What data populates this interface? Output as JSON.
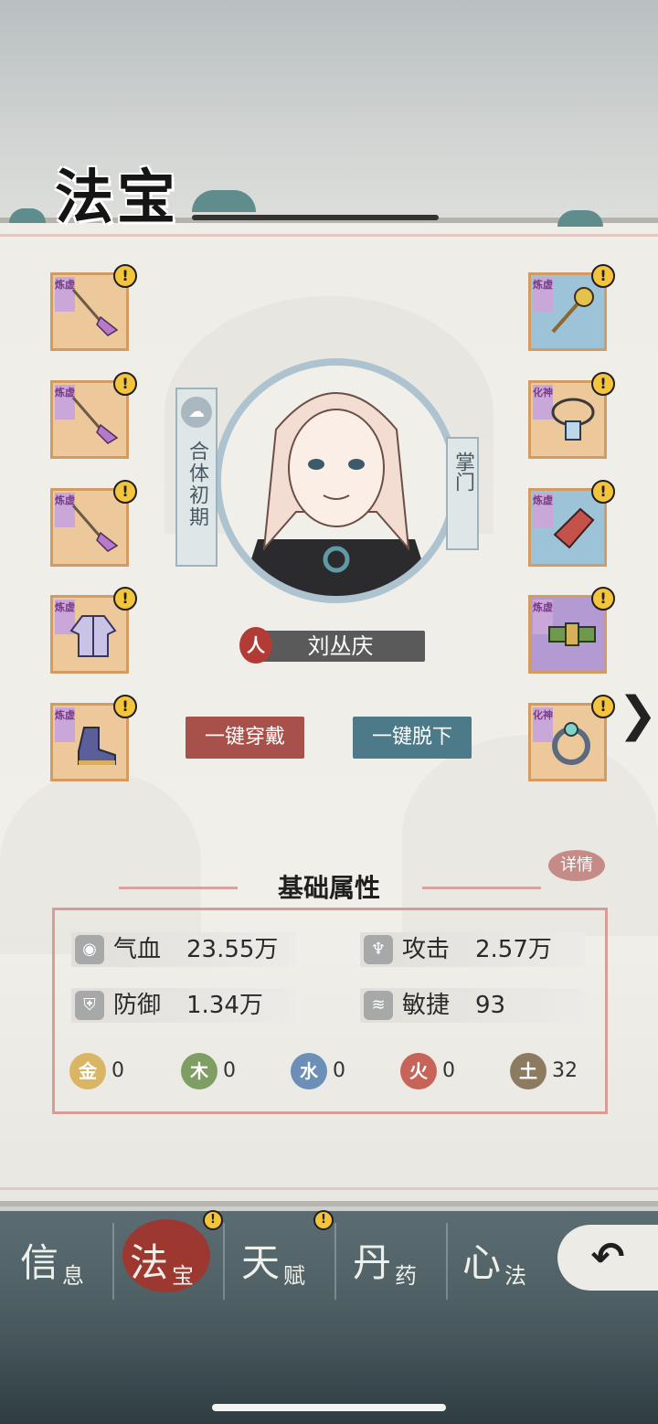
{
  "page": {
    "title": "法宝"
  },
  "slots_left": [
    {
      "tag": "炼虚",
      "icon": "polearm-icon",
      "badge": "!"
    },
    {
      "tag": "炼虚",
      "icon": "polearm-icon",
      "badge": "!"
    },
    {
      "tag": "炼虚",
      "icon": "polearm-icon",
      "badge": "!"
    },
    {
      "tag": "炼虚",
      "icon": "robe-icon",
      "badge": "!"
    },
    {
      "tag": "炼虚",
      "icon": "boots-icon",
      "badge": "!"
    }
  ],
  "slots_right": [
    {
      "tag": "炼虚",
      "icon": "hairpin-icon",
      "badge": "!"
    },
    {
      "tag": "化神",
      "icon": "necklace-icon",
      "badge": "!"
    },
    {
      "tag": "炼虚",
      "icon": "bracer-icon",
      "badge": "!"
    },
    {
      "tag": "炼虚",
      "icon": "belt-icon",
      "badge": "!"
    },
    {
      "tag": "化神",
      "icon": "ring-icon",
      "badge": "!"
    }
  ],
  "character": {
    "realm": "合体初期",
    "position": "掌门",
    "name_icon_char": "人",
    "name": "刘丛庆"
  },
  "buttons": {
    "equip_all": "一键穿戴",
    "unequip_all": "一键脱下",
    "detail": "详情"
  },
  "attributes": {
    "title": "基础属性",
    "stats": [
      {
        "label": "气血",
        "value": "23.55万",
        "icon": "blood-drop-icon"
      },
      {
        "label": "攻击",
        "value": "2.57万",
        "icon": "attack-icon"
      },
      {
        "label": "防御",
        "value": "1.34万",
        "icon": "shield-icon"
      },
      {
        "label": "敏捷",
        "value": "93",
        "icon": "wind-icon"
      }
    ],
    "elements": [
      {
        "char": "金",
        "value": "0",
        "color": "#d9b564"
      },
      {
        "char": "木",
        "value": "0",
        "color": "#7e9e63"
      },
      {
        "char": "水",
        "value": "0",
        "color": "#6b8fb6"
      },
      {
        "char": "火",
        "value": "0",
        "color": "#c7645a"
      },
      {
        "char": "土",
        "value": "32",
        "color": "#8c7b60"
      }
    ]
  },
  "tabs": [
    {
      "big": "信",
      "small": "息"
    },
    {
      "big": "法",
      "small": "宝",
      "badge": "!"
    },
    {
      "big": "天",
      "small": "赋",
      "badge": "!"
    },
    {
      "big": "丹",
      "small": "药"
    },
    {
      "big": "心",
      "small": "法"
    }
  ],
  "colors": {
    "accent_red": "#a8514a",
    "accent_blue": "#4d7a88",
    "badge": "#f4c53a"
  }
}
